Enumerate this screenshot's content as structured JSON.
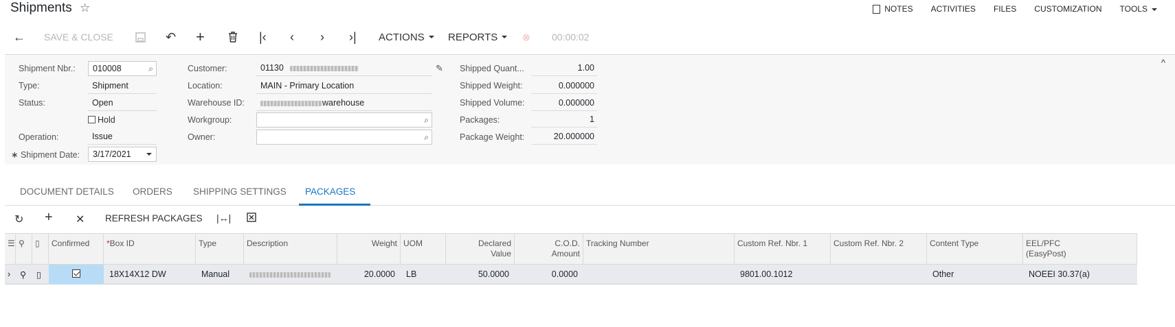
{
  "header": {
    "title": "Shipments",
    "nav": [
      "NOTES",
      "ACTIVITIES",
      "FILES",
      "CUSTOMIZATION",
      "TOOLS"
    ]
  },
  "toolbar": {
    "save_close": "SAVE & CLOSE",
    "actions": "ACTIONS",
    "reports": "REPORTS",
    "timer": "00:00:02"
  },
  "form": {
    "shipment_nbr_label": "Shipment Nbr.:",
    "shipment_nbr": "010008",
    "type_label": "Type:",
    "type": "Shipment",
    "status_label": "Status:",
    "status": "Open",
    "hold_label": "Hold",
    "operation_label": "Operation:",
    "operation": "Issue",
    "shipment_date_label": "Shipment Date:",
    "shipment_date": "3/17/2021",
    "customer_label": "Customer:",
    "customer": "01130",
    "location_label": "Location:",
    "location": "MAIN - Primary Location",
    "warehouse_label": "Warehouse ID:",
    "warehouse_suffix": "warehouse",
    "workgroup_label": "Workgroup:",
    "owner_label": "Owner:",
    "shipped_qty_label": "Shipped Quant...",
    "shipped_qty": "1.00",
    "shipped_weight_label": "Shipped Weight:",
    "shipped_weight": "0.000000",
    "shipped_volume_label": "Shipped Volume:",
    "shipped_volume": "0.000000",
    "packages_label": "Packages:",
    "packages": "1",
    "package_weight_label": "Package Weight:",
    "package_weight": "20.000000"
  },
  "tabs": [
    "DOCUMENT DETAILS",
    "ORDERS",
    "SHIPPING SETTINGS",
    "PACKAGES"
  ],
  "grid_toolbar": {
    "refresh": "REFRESH PACKAGES"
  },
  "grid": {
    "columns": [
      "Confirmed",
      "Box ID",
      "Type",
      "Description",
      "Weight",
      "UOM",
      "Declared Value",
      "C.O.D. Amount",
      "Tracking Number",
      "Custom Ref. Nbr. 1",
      "Custom Ref. Nbr. 2",
      "Content Type",
      "EEL/PFC (EasyPost)"
    ],
    "col_declared_1": "Declared",
    "col_declared_2": "Value",
    "col_cod_1": "C.O.D.",
    "col_cod_2": "Amount",
    "col_eel_1": "EEL/PFC",
    "col_eel_2": "(EasyPost)",
    "row": {
      "box_id": "18X14X12 DW",
      "type": "Manual",
      "weight": "20.0000",
      "uom": "LB",
      "declared_value": "50.0000",
      "cod_amount": "0.0000",
      "tracking_number": "",
      "custom_ref_1": "9801.00.1012",
      "custom_ref_2": "",
      "content_type": "Other",
      "eel_pfc": "NOEEI 30.37(a)"
    }
  }
}
